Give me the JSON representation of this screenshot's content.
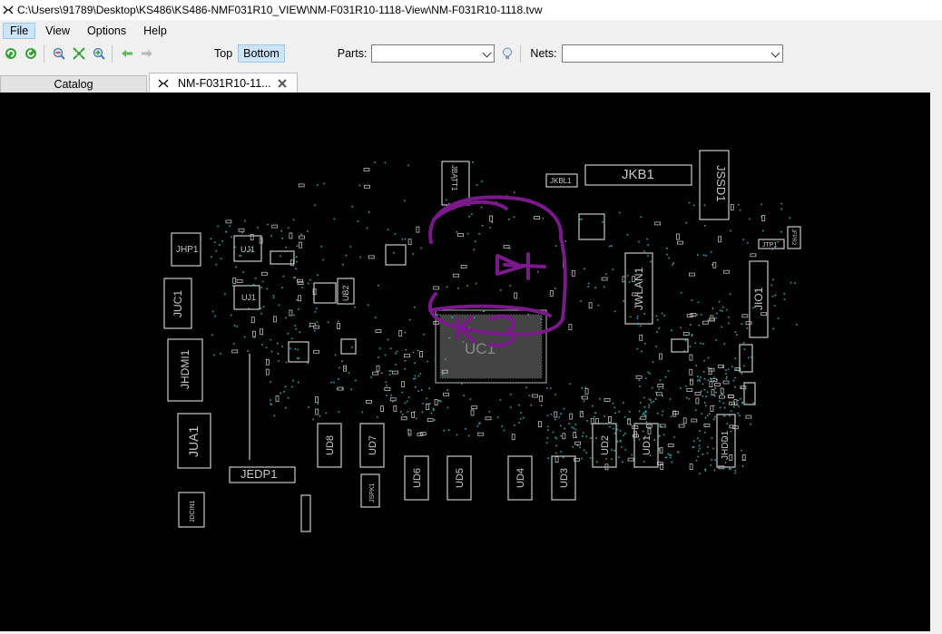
{
  "window": {
    "title": "C:\\Users\\91789\\Desktop\\KS486\\KS486-NMF031R10_VIEW\\NM-F031R10-1118-View\\NM-F031R10-1118.tvw"
  },
  "menu": {
    "file": "File",
    "view": "View",
    "options": "Options",
    "help": "Help"
  },
  "toolbar": {
    "top_label": "Top",
    "bottom_label": "Bottom",
    "parts_label": "Parts:",
    "parts_value": "",
    "nets_label": "Nets:",
    "nets_value": "",
    "icons": [
      "refresh-icon",
      "refresh-alt-icon",
      "zoom-out-icon",
      "fit-icon",
      "zoom-in-icon",
      "back-arrow-icon",
      "forward-arrow-icon",
      "lightbulb-icon"
    ]
  },
  "tabs": {
    "catalog": "Catalog",
    "file": "NM-F031R10-11..."
  },
  "board": {
    "components": [
      "JKB1",
      "JSSD1",
      "JKBL1",
      "BATT1",
      "JHP1",
      "UJ1",
      "JUC1",
      "JHDMI1",
      "JUA1",
      "JEDP1",
      "JDCIN1",
      "JSPK1",
      "JWLAN1",
      "JIO1",
      "JTP1",
      "JHDD1",
      "UC1",
      "UB2",
      "UD8",
      "UD7",
      "UD6",
      "UD5",
      "UD4",
      "UD3",
      "UD2",
      "UD1",
      "JFPR2",
      "KB1"
    ],
    "colors": {
      "background": "#000000",
      "outline": "#c8c8c8",
      "pads": "#3aa0a0",
      "annotation": "#7a1a8a"
    }
  }
}
